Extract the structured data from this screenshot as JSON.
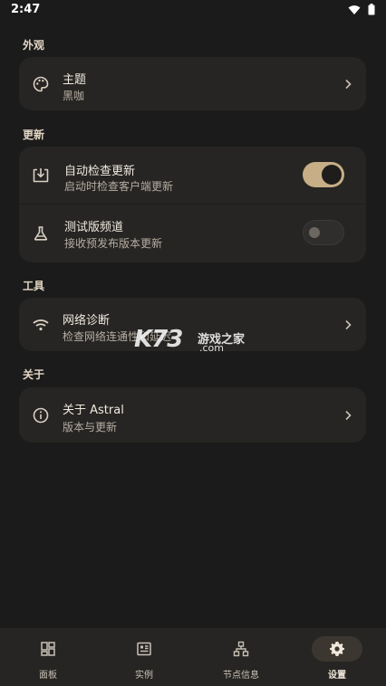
{
  "status_bar": {
    "time": "2:47"
  },
  "sections": {
    "appearance": {
      "title": "外观",
      "theme": {
        "title": "主题",
        "subtitle": "黑咖"
      }
    },
    "update": {
      "title": "更新",
      "auto_check": {
        "title": "自动检查更新",
        "subtitle": "启动时检查客户端更新",
        "enabled": true
      },
      "beta": {
        "title": "测试版频道",
        "subtitle": "接收预发布版本更新",
        "enabled": false
      }
    },
    "tools": {
      "title": "工具",
      "network": {
        "title": "网络诊断",
        "subtitle": "检查网络连通性和延迟"
      }
    },
    "about": {
      "title": "关于",
      "about_app": {
        "title": "关于 Astral",
        "subtitle": "版本与更新"
      }
    }
  },
  "watermark": {
    "logo": "K73",
    "site": "游戏之家",
    "domain": ".com"
  },
  "bottom_nav": {
    "items": [
      {
        "label": "面板",
        "icon": "dashboard-icon"
      },
      {
        "label": "实例",
        "icon": "instance-icon"
      },
      {
        "label": "节点信息",
        "icon": "node-tree-icon"
      },
      {
        "label": "设置",
        "icon": "gear-icon",
        "active": true
      }
    ]
  },
  "colors": {
    "accent": "#c7ae86",
    "background": "#1b1b1b",
    "card": "#262523"
  }
}
